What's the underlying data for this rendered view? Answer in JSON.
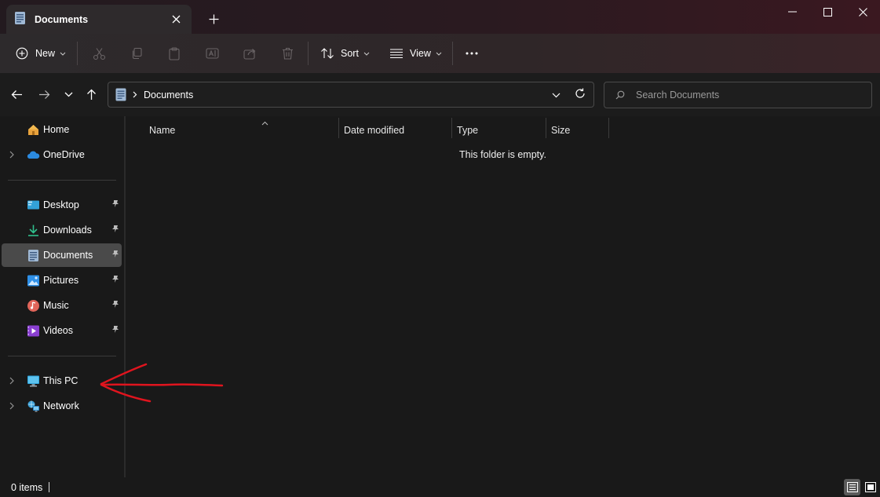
{
  "window": {
    "tab_title": "Documents",
    "new_tab_label": "+"
  },
  "toolbar": {
    "new_label": "New",
    "sort_label": "Sort",
    "view_label": "View"
  },
  "address": {
    "path": "Documents"
  },
  "search": {
    "placeholder": "Search Documents"
  },
  "sidebar": {
    "items": [
      {
        "label": "Home"
      },
      {
        "label": "OneDrive"
      },
      {
        "label": "Desktop"
      },
      {
        "label": "Downloads"
      },
      {
        "label": "Documents"
      },
      {
        "label": "Pictures"
      },
      {
        "label": "Music"
      },
      {
        "label": "Videos"
      },
      {
        "label": "This PC"
      },
      {
        "label": "Network"
      }
    ]
  },
  "columns": {
    "name": "Name",
    "date_modified": "Date modified",
    "type": "Type",
    "size": "Size"
  },
  "content": {
    "empty_message": "This folder is empty."
  },
  "status": {
    "items_count": "0 items"
  },
  "colors": {
    "background": "#191919",
    "accent_annotation": "#e0141e",
    "active_item": "#4a4a4a"
  }
}
